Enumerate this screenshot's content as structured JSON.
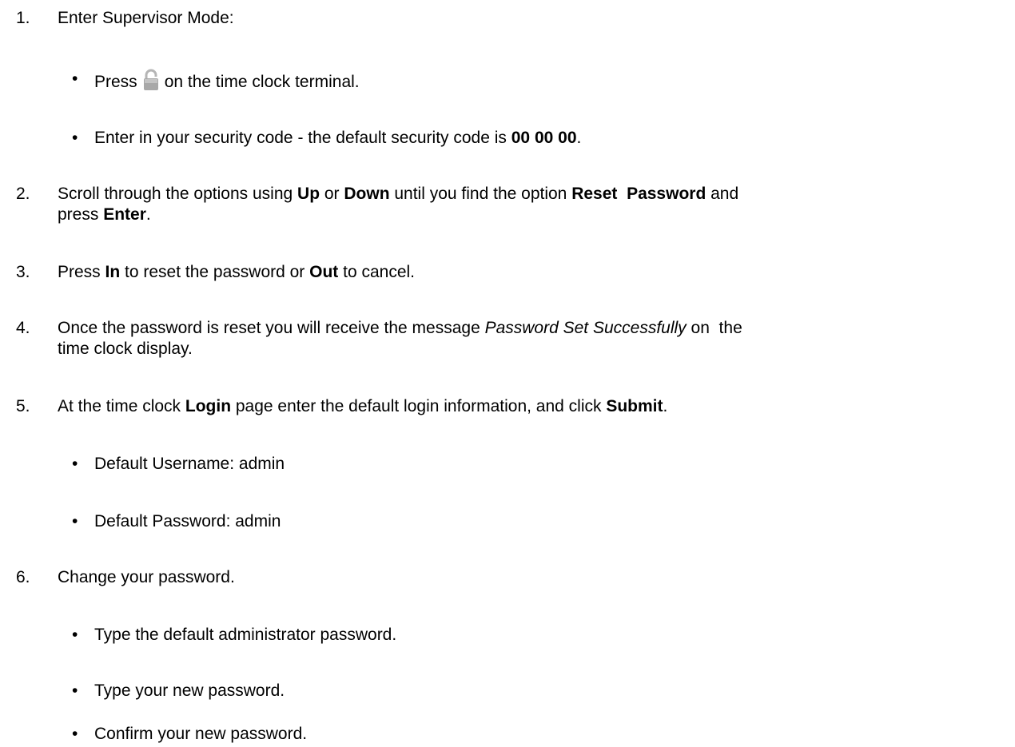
{
  "steps": [
    {
      "num": "1.",
      "text": "Enter Supervisor Mode:",
      "bullets": [
        {
          "pre": "Press",
          "icon": "lock-icon",
          "post": "on the time clock terminal."
        },
        {
          "pre": "Enter in your security code - the default security code is ",
          "bold": "00 00 00",
          "post": "."
        }
      ]
    },
    {
      "num": "2.",
      "line1": {
        "a": "Scroll through the options using ",
        "b1": "Up",
        "c": " or ",
        "b2": "Down",
        "d": " until you find the option ",
        "b3": "Reset  Password",
        "e": " and"
      },
      "line2": {
        "a": "press ",
        "b1": "Enter",
        "c": "."
      }
    },
    {
      "num": "3.",
      "parts": {
        "a": "Press ",
        "b1": "In",
        "c": " to reset the password or ",
        "b2": "Out",
        "d": " to cancel."
      }
    },
    {
      "num": "4.",
      "line1": {
        "a": "Once the password is reset you will receive the message ",
        "i": "Password Set Successfully",
        "c": " on  the"
      },
      "line2": "time clock display."
    },
    {
      "num": "5.",
      "parts": {
        "a": "At the time clock ",
        "b1": "Login",
        "c": " page enter the default login information, and click ",
        "b2": "Submit",
        "d": "."
      },
      "bullets": [
        "Default Username: admin",
        "Default Password: admin"
      ]
    },
    {
      "num": "6.",
      "text": "Change your password.",
      "bullets": [
        "Type the default administrator password.",
        "Type your new password.",
        "Confirm your new password."
      ]
    }
  ],
  "bullet_char": "•",
  "colors": {
    "text": "#000000",
    "icon": "#a8a8a8"
  }
}
